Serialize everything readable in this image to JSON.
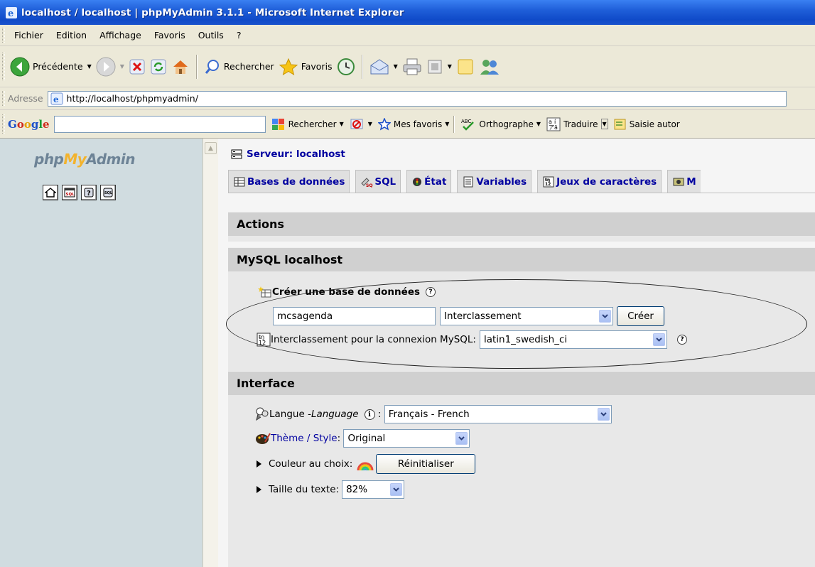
{
  "window": {
    "title": "localhost / localhost | phpMyAdmin 3.1.1 - Microsoft Internet Explorer"
  },
  "menu": [
    "Fichier",
    "Edition",
    "Affichage",
    "Favoris",
    "Outils",
    "?"
  ],
  "toolbar": {
    "back": "Précédente",
    "search": "Rechercher",
    "favorites": "Favoris"
  },
  "address": {
    "label": "Adresse",
    "url": "http://localhost/phpmyadmin/"
  },
  "googlebar": {
    "logo": "Google",
    "search": "Rechercher",
    "favorites": "Mes favoris",
    "spell": "Orthographe",
    "translate": "Traduire",
    "autofill": "Saisie autor"
  },
  "left": {
    "logo_php": "php",
    "logo_my": "My",
    "logo_admin": "Admin"
  },
  "server": {
    "label": "Serveur: localhost"
  },
  "tabs": [
    "Bases de données",
    "SQL",
    "État",
    "Variables",
    "Jeux de caractères",
    "M"
  ],
  "sections": {
    "actions": "Actions",
    "mysql": "MySQL localhost",
    "interface": "Interface"
  },
  "createdb": {
    "label": "Créer une base de données",
    "name_value": "mcsagenda",
    "collation_value": "Interclassement",
    "button": "Créer"
  },
  "conn_collation": {
    "label": "Interclassement pour la connexion MySQL:",
    "value": "latin1_swedish_ci"
  },
  "interface": {
    "lang_label": "Langue - ",
    "lang_label_em": "Language",
    "lang_value": "Français - French",
    "theme_label": "Thème / Style",
    "theme_value": "Original",
    "color_label": "Couleur au choix:",
    "reset_button": "Réinitialiser",
    "fontsize_label": "Taille du texte:",
    "fontsize_value": "82%"
  }
}
